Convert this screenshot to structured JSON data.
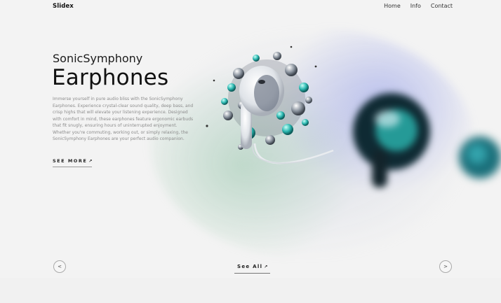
{
  "header": {
    "brand": "Slidex",
    "nav": [
      "Home",
      "Info",
      "Contact"
    ]
  },
  "hero": {
    "subtitle": "SonicSymphony",
    "title": "Earphones",
    "description": "Immerse yourself in pure audio bliss with the SonicSymphony Earphones. Experience crystal-clear sound quality, deep bass, and crisp highs that will elevate your listening experience. Designed with comfort in mind, these earphones feature ergonomic earbuds that fit snugly, ensuring hours of uninterrupted enjoyment. Whether you're commuting, working out, or simply relaxing, the SonicSymphony Earphones are your perfect audio companion.",
    "see_more": "SEE MORE",
    "see_more_arrow": "↗"
  },
  "controls": {
    "prev": "<",
    "next": ">",
    "see_all": "See All",
    "see_all_arrow": "↗"
  },
  "colors": {
    "accent_teal": "#2bb7b0",
    "glow_blue": "#96a0eb",
    "glow_green": "#a0cdaf"
  }
}
